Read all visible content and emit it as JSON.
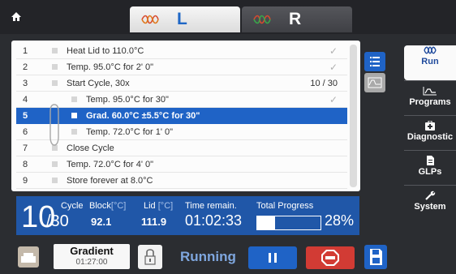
{
  "header": {
    "block_left": "L",
    "block_right": "R"
  },
  "program": {
    "steps": [
      {
        "num": "1",
        "text": "Heat Lid to 110.0°C",
        "status": "✓"
      },
      {
        "num": "2",
        "text": "Temp.  95.0°C for 2' 0\"",
        "status": "✓"
      },
      {
        "num": "3",
        "text": "Start Cycle, 30x",
        "status": "10 / 30"
      },
      {
        "num": "4",
        "text": "Temp.  95.0°C for 30\"",
        "status": "✓"
      },
      {
        "num": "5",
        "text": "Grad.  60.0°C ±5.5°C  for 30\"",
        "status": ""
      },
      {
        "num": "6",
        "text": "Temp.  72.0°C for 1' 0\"",
        "status": ""
      },
      {
        "num": "7",
        "text": "Close Cycle",
        "status": ""
      },
      {
        "num": "8",
        "text": "Temp.  72.0°C for 4' 0\"",
        "status": ""
      },
      {
        "num": "9",
        "text": "Store forever at 8.0°C",
        "status": ""
      }
    ],
    "active_step": 5
  },
  "nav": {
    "run": "Run",
    "programs": "Programs",
    "diagnostic": "Diagnostic",
    "glps": "GLPs",
    "system": "System"
  },
  "status": {
    "cycle_current": "10",
    "cycle_total": "/30",
    "cycle_label": "Cycle",
    "block_label": "Block",
    "block_unit": "[°C]",
    "block_value": "92.1",
    "lid_label": "Lid",
    "lid_unit": "[°C]",
    "lid_value": "111.9",
    "time_label": "Time remain.",
    "time_value": "01:02:33",
    "progress_label": "Total Progress",
    "progress_fraction": 0.28,
    "progress_text": "28%"
  },
  "footer": {
    "gradient_title": "Gradient",
    "gradient_time": "01:27:00",
    "state": "Running"
  },
  "colors": {
    "accent_blue": "#1f63c6",
    "status_blue": "#2057a8",
    "stop_red": "#d23b34",
    "background": "#2b2d31"
  }
}
